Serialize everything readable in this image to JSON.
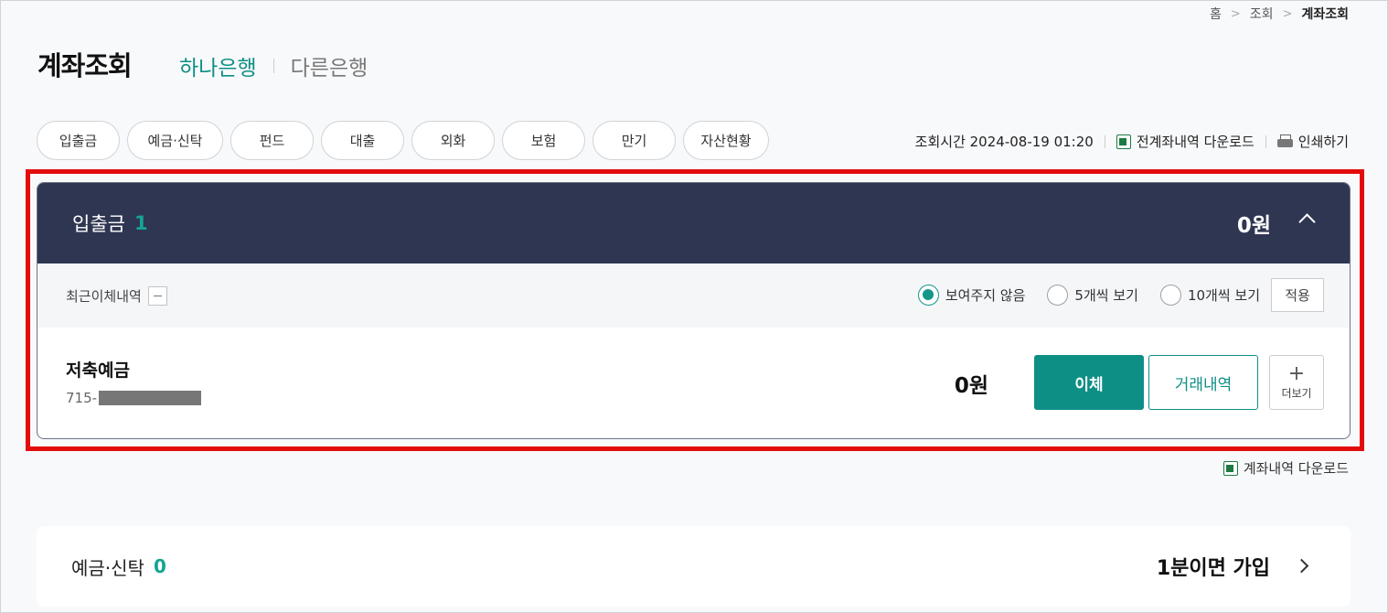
{
  "breadcrumb": [
    "홈",
    "조회",
    "계좌조회"
  ],
  "page": {
    "title": "계좌조회"
  },
  "bank_tabs": [
    {
      "label": "하나은행",
      "active": true
    },
    {
      "label": "다른은행",
      "active": false
    }
  ],
  "chips": [
    "입출금",
    "예금·신탁",
    "펀드",
    "대출",
    "외화",
    "보험",
    "만기",
    "자산현황"
  ],
  "top_actions": {
    "query_time": "조회시간 2024-08-19 01:20",
    "download_all": "전계좌내역 다운로드",
    "print": "인쇄하기"
  },
  "section_deposit": {
    "label": "입출금",
    "count": "1",
    "total": "0원",
    "recent_title": "최근이체내역",
    "radio_options": [
      {
        "label": "보여주지 않음",
        "checked": true
      },
      {
        "label": "5개씩 보기",
        "checked": false
      },
      {
        "label": "10개씩 보기",
        "checked": false
      }
    ],
    "apply_label": "적용",
    "account": {
      "name": "저축예금",
      "number_prefix": "715-",
      "balance": "0원",
      "transfer_label": "이체",
      "history_label": "거래내역",
      "more_label": "더보기"
    }
  },
  "account_download": "계좌내역 다운로드",
  "section_trust": {
    "label": "예금·신탁",
    "count": "0",
    "join_label": "1분이면 가입"
  },
  "colors": {
    "accent": "#0e8f86",
    "header_bg": "#2f3651",
    "highlight": "#e30c0c"
  }
}
